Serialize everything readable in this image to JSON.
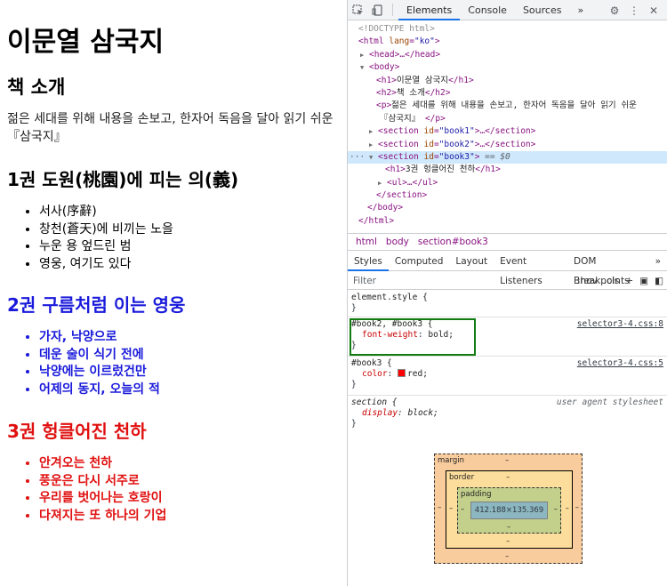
{
  "page": {
    "title": "이문열 삼국지",
    "intro_heading": "책 소개",
    "intro_text": "젊은 세대를 위해 내용을 손보고, 한자어 독음을 달아 읽기 쉬운『삼국지』",
    "books": [
      {
        "heading": "1권 도원(桃園)에 피는 의(義)",
        "items": [
          "서사(序辭)",
          "창천(蒼天)에 비끼는 노을",
          "누운 용 엎드린 범",
          "영웅, 여기도 있다"
        ]
      },
      {
        "heading": "2권 구름처럼 이는 영웅",
        "items": [
          "가자, 낙양으로",
          "데운 술이 식기 전에",
          "낙양에는 이르렀건만",
          "어제의 동지, 오늘의 적"
        ]
      },
      {
        "heading": "3권 헝클어진 천하",
        "items": [
          "안겨오는 천하",
          "풍운은 다시 서주로",
          "우리를 벗어나는 호랑이",
          "다져지는 또 하나의 기업"
        ]
      }
    ]
  },
  "colors": {
    "book2": "#1a1adb",
    "book3": "#e01010",
    "highlight_border": "#107c10",
    "tab_active": "#1a73e8"
  },
  "devtools": {
    "top_tabs": [
      "Elements",
      "Console",
      "Sources",
      "»"
    ],
    "icons": [
      "inspect-icon",
      "device-toolbar-icon",
      "settings-gear-icon",
      "more-vert-icon",
      "close-icon"
    ],
    "dom": {
      "doctype": "<!DOCTYPE html>",
      "html_open_tag": "html",
      "html_lang_attr": "lang",
      "html_lang_val": "\"ko\"",
      "head": "<head>…</head>",
      "body_open": "<body>",
      "h1_text": "이문열 삼국지",
      "h2_text": "책 소개",
      "p_text_1": "젊은 세대를 위해 내용을 손보고, 한자어 독음을 달아 읽기 쉬운",
      "p_text_2": "『삼국지』",
      "section_book1": "\"book1\"",
      "section_book2": "\"book2\"",
      "section_book3": "\"book3\"",
      "selected_suffix": " == $0",
      "h1_book3": "3권 헝클어진 천하",
      "ul_collapsed": "<ul>…</ul>",
      "section_close": "</section>",
      "body_close": "</body>",
      "html_close": "</html>"
    },
    "breadcrumbs": [
      "html",
      "body",
      "section#book3"
    ],
    "styles_tabs": [
      "Styles",
      "Computed",
      "Layout",
      "Event Listeners",
      "DOM Breakpoints",
      "»"
    ],
    "filter": {
      "placeholder": "Filter",
      "hov": ":hov",
      "cls": ".cls",
      "plus": "+"
    },
    "rules": [
      {
        "selector": "element.style {",
        "close": "}"
      },
      {
        "selector": "#book2, #book3 {",
        "source": "selector3-4.css:8",
        "prop": "font-weight",
        "value": "bold;",
        "close": "}"
      },
      {
        "selector": "#book3 {",
        "source": "selector3-4.css:5",
        "prop": "color",
        "value": "red;",
        "close": "}"
      },
      {
        "selector": "section {",
        "source": "user agent stylesheet",
        "prop": "display",
        "value": "block;",
        "close": "}"
      }
    ],
    "box_model": {
      "margin_label": "margin",
      "border_label": "border",
      "padding_label": "padding",
      "content": "412.188×135.369",
      "dash": "–"
    }
  }
}
